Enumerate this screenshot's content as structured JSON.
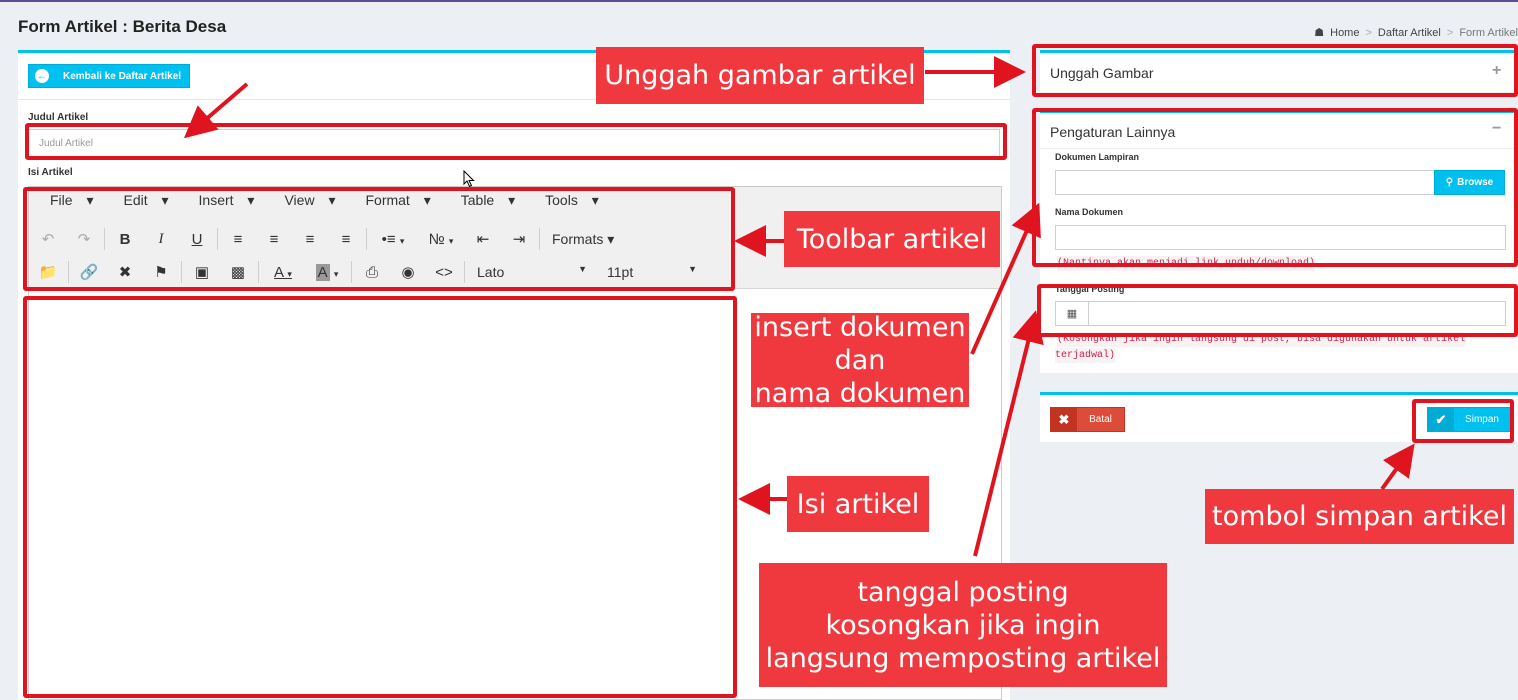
{
  "page": {
    "title": "Form Artikel : Berita Desa"
  },
  "breadcrumb": {
    "home": "Home",
    "list": "Daftar Artikel",
    "current": "Form Artikel"
  },
  "form": {
    "back_button": "Kembali ke Daftar Artikel",
    "title_label": "Judul Artikel",
    "title_placeholder": "Judul Artikel",
    "content_label": "Isi Artikel"
  },
  "editor": {
    "menus": [
      "File",
      "Edit",
      "Insert",
      "View",
      "Format",
      "Table",
      "Tools"
    ],
    "formats_label": "Formats",
    "font_family": "Lato",
    "font_size": "11pt"
  },
  "sidebar": {
    "upload": {
      "title": "Unggah Gambar",
      "toggle": "+"
    },
    "settings": {
      "title": "Pengaturan Lainnya",
      "toggle": "−",
      "doc_label": "Dokumen Lampiran",
      "browse": "Browse",
      "docname_label": "Nama Dokumen",
      "docname_hint": "(Nantinya akan menjadi link unduh/download)",
      "date_label": "Tanggal Posting",
      "date_hint_1": "(Kosongkan jika ingin langsung di post, bisa digunakan untuk artikel",
      "date_hint_2": "terjadwal)"
    },
    "actions": {
      "cancel": "Batal",
      "save": "Simpan"
    }
  },
  "annotations": {
    "upload": "Unggah gambar artikel",
    "toolbar": "Toolbar artikel",
    "document_1": "insert dokumen",
    "document_2": "dan",
    "document_3": "nama dokumen",
    "content": "Isi artikel",
    "save": "tombol simpan artikel",
    "date_1": "tanggal posting",
    "date_2": "kosongkan jika ingin",
    "date_3": "langsung memposting artikel"
  },
  "colors": {
    "accent": "#00c0ef",
    "danger": "#dd4b39",
    "annotation": "#f0393f",
    "highlight": "#e0141e"
  }
}
